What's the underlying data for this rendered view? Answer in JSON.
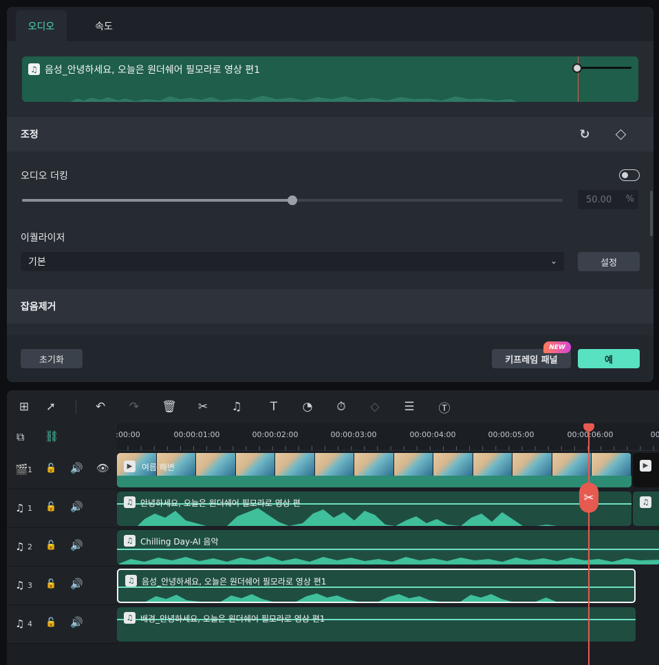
{
  "tabs": [
    {
      "label": "오디오",
      "active": true
    },
    {
      "label": "속도",
      "active": false
    }
  ],
  "preview": {
    "title": "음성_안녕하세요, 오늘은 원더쉐어 필모라로 영상 편1"
  },
  "sections": {
    "adjust": {
      "title": "조정"
    },
    "noise": {
      "title": "잡음제거"
    }
  },
  "ducking": {
    "label": "오디오 더킹",
    "enabled": false,
    "value": "50.00",
    "unit": "%",
    "level": 0.5
  },
  "equalizer": {
    "label": "이퀄라이저",
    "selected": "기본",
    "settings_label": "설정"
  },
  "footer": {
    "reset_label": "초기화",
    "keyframe_label": "키프레임 패널",
    "new_badge": "NEW",
    "ok_label": "예"
  },
  "colors": {
    "accent": "#4fd8b6",
    "ok_button": "#58e2c2",
    "playhead": "#e65a4f",
    "audio_clip": "#1f4e41"
  },
  "toolbar_icons": [
    "layout-icon",
    "select-tool-icon",
    "undo-icon",
    "redo-icon",
    "delete-icon",
    "cut-icon",
    "audio-edit-icon",
    "text-icon",
    "speed-icon",
    "timer-icon",
    "keyframe-icon",
    "adjust-icon",
    "speech-to-text-icon"
  ],
  "ruler": {
    "labels": [
      ":00:00",
      "00:00:01:00",
      "00:00:02:00",
      "00:00:03:00",
      "00:00:04:00",
      "00:00:05:00",
      "00:00:06:00",
      "00:0"
    ]
  },
  "tracks": [
    {
      "type": "video",
      "index": "1",
      "clip": "여름 해변"
    },
    {
      "type": "audio",
      "index": "1",
      "clip": "안녕하세요, 오늘은 원더쉐어 필모라로 영상 편"
    },
    {
      "type": "audio",
      "index": "2",
      "clip": "Chilling Day-AI 음악"
    },
    {
      "type": "audio",
      "index": "3",
      "clip": "음성_안녕하세요, 오늘은 원더쉐어 필모라로 영상 편1"
    },
    {
      "type": "audio",
      "index": "4",
      "clip": "배경_안녕하세요, 오늘은 원더쉐어 필모라로 영상 편1"
    }
  ]
}
